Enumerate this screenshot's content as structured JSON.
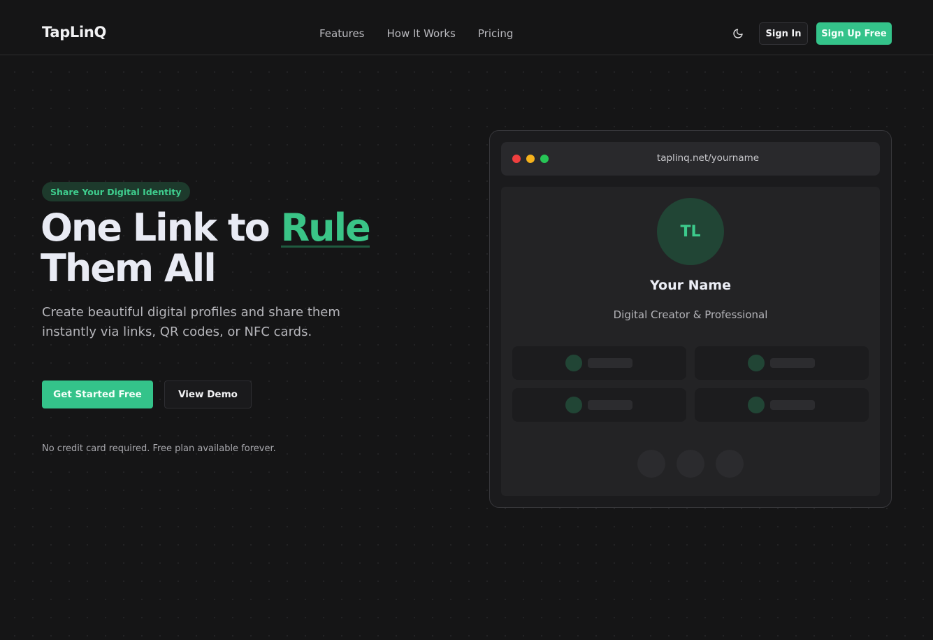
{
  "header": {
    "logo": "TapLinQ",
    "nav": [
      "Features",
      "How It Works",
      "Pricing"
    ],
    "theme_icon": "moon-icon",
    "sign_in": "Sign In",
    "sign_up": "Sign Up Free"
  },
  "hero": {
    "badge": "Share Your Digital Identity",
    "headline_prefix": "One Link to ",
    "headline_accent": "Rule",
    "headline_line2": "Them All",
    "subtitle": "Create beautiful digital profiles and share them instantly via links, QR codes, or NFC cards.",
    "primary_cta": "Get Started Free",
    "secondary_cta": "View Demo",
    "note": "No credit card required. Free plan available forever."
  },
  "mockup": {
    "url": "taplinq.net/yourname",
    "avatar_initials": "TL",
    "name": "Your Name",
    "role": "Digital Creator & Professional"
  },
  "colors": {
    "background": "#151516",
    "accent": "#34c38a",
    "text": "#e9ebf4"
  }
}
